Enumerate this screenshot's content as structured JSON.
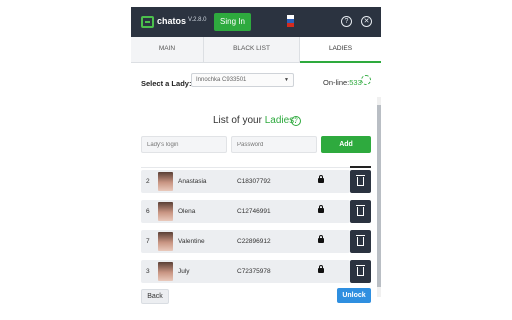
{
  "header": {
    "brand": "chatos",
    "version": "V.2.8.0",
    "signin_label": "Sing In",
    "flag_icon": "ru-flag-icon",
    "help_symbol": "?",
    "close_symbol": "✕"
  },
  "tabs": [
    {
      "label": "MAIN",
      "active": false
    },
    {
      "label": "BLACK LIST",
      "active": false
    },
    {
      "label": "LADIES",
      "active": true
    }
  ],
  "lady_select": {
    "label": "Select a Lady:",
    "value": "Innochka C933501"
  },
  "online": {
    "label": "On-line:",
    "count": "533"
  },
  "list": {
    "title_prefix": "List of your ",
    "title_accent": "Ladies:",
    "info_symbol": "?",
    "login_placeholder": "Lady's login",
    "password_placeholder": "Password",
    "add_label": "Add"
  },
  "ladies": [
    {
      "num": "2",
      "name": "Anastasia",
      "code": "C18307792"
    },
    {
      "num": "6",
      "name": "Olena",
      "code": "C12746991"
    },
    {
      "num": "7",
      "name": "Valentine",
      "code": "C22896912"
    },
    {
      "num": "3",
      "name": "July",
      "code": "C72375978"
    }
  ],
  "footer": {
    "back_label": "Back",
    "unlock_label": "Unlock"
  },
  "colors": {
    "accent": "#2eaa3e",
    "header_bg": "#2b3340",
    "unlock": "#2f8fe0"
  }
}
